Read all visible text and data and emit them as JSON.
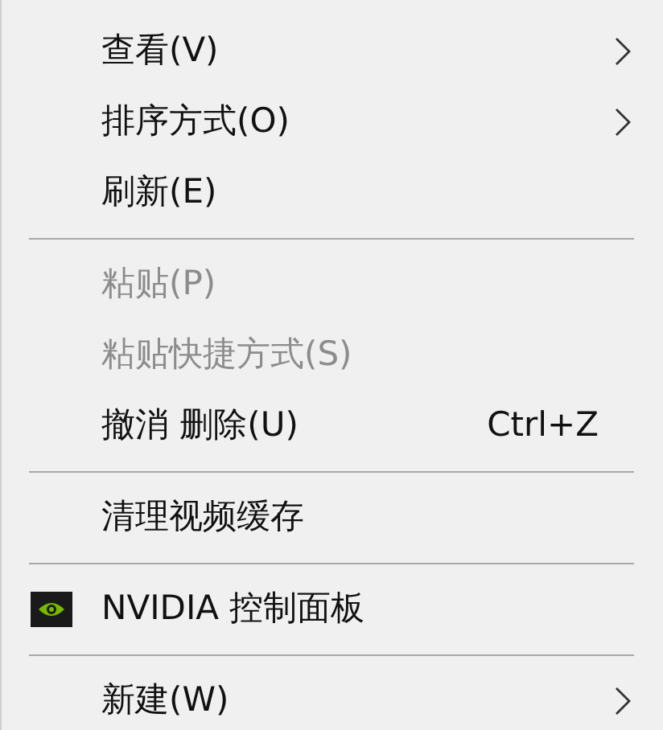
{
  "menu": {
    "items": [
      {
        "kind": "item",
        "label": "查看(V)",
        "submenu": true,
        "disabled": false
      },
      {
        "kind": "item",
        "label": "排序方式(O)",
        "submenu": true,
        "disabled": false
      },
      {
        "kind": "item",
        "label": "刷新(E)",
        "submenu": false,
        "disabled": false
      },
      {
        "kind": "separator"
      },
      {
        "kind": "item",
        "label": "粘贴(P)",
        "submenu": false,
        "disabled": true
      },
      {
        "kind": "item",
        "label": "粘贴快捷方式(S)",
        "submenu": false,
        "disabled": true
      },
      {
        "kind": "item",
        "label": "撤消 删除(U)",
        "shortcut": "Ctrl+Z",
        "submenu": false,
        "disabled": false
      },
      {
        "kind": "separator"
      },
      {
        "kind": "item",
        "label": "清理视频缓存",
        "submenu": false,
        "disabled": false
      },
      {
        "kind": "separator"
      },
      {
        "kind": "app_item",
        "label": "NVIDIA 控制面板",
        "submenu": false,
        "disabled": false
      },
      {
        "kind": "separator"
      },
      {
        "kind": "item",
        "label": "新建(W)",
        "submenu": true,
        "disabled": false
      }
    ]
  }
}
